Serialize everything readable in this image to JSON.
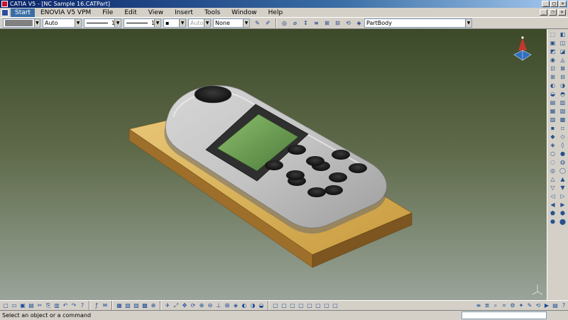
{
  "window": {
    "title": "CATIA V5 - [NC Sample 16.CATPart]"
  },
  "menu": {
    "items": [
      "Start",
      "ENOVIA V5 VPM",
      "File",
      "Edit",
      "View",
      "Insert",
      "Tools",
      "Window",
      "Help"
    ]
  },
  "properties_toolbar": {
    "color_value": "",
    "transparency_value": "Auto",
    "line_thickness_value": "1",
    "line_type_value": "1",
    "point_symbol_value": "▪",
    "rendering_style_value": "Auto",
    "layer_value": "None",
    "current_body_value": "PartBody"
  },
  "status": {
    "message": "Select an object or a command"
  },
  "colors": {
    "viewport_top": "#3d4a29",
    "viewport_bottom": "#9aa49a",
    "stock_block": "#d8b25a",
    "part_body": "#c9c9c9",
    "screen_glass": "#6f9a56"
  },
  "icons": {
    "compass": "compass-icon",
    "axis_triad": "axis-triad-icon"
  }
}
